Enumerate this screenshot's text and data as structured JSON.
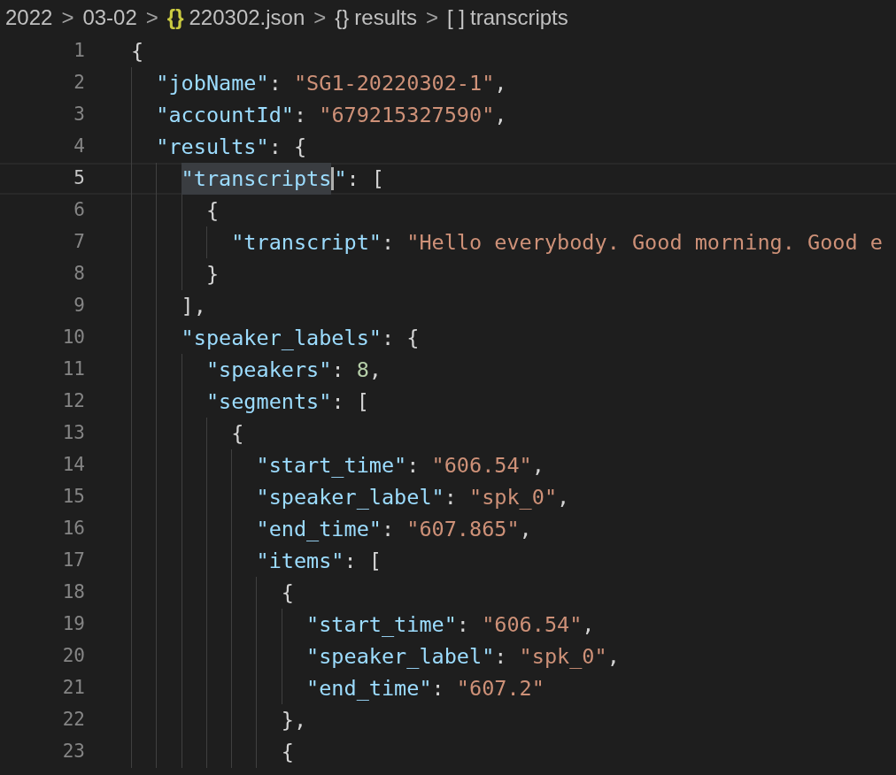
{
  "breadcrumb": [
    {
      "kind": "folder",
      "label": "2022"
    },
    {
      "kind": "folder",
      "label": "03-02"
    },
    {
      "kind": "file",
      "icon": "{}",
      "label": "220302.json"
    },
    {
      "kind": "object",
      "icon": "{}",
      "label": "results"
    },
    {
      "kind": "array",
      "icon": "[ ]",
      "label": "transcripts"
    }
  ],
  "separator": ">",
  "lines": [
    {
      "number": "1",
      "current": false,
      "tokens": [
        {
          "kind": "punct",
          "text": "{"
        }
      ]
    },
    {
      "number": "2",
      "current": false,
      "tokens": [
        {
          "kind": "key",
          "text": "  \"jobName\""
        },
        {
          "kind": "punct",
          "text": ": "
        },
        {
          "kind": "string",
          "text": "\"SG1-20220302-1\""
        },
        {
          "kind": "punct",
          "text": ","
        }
      ]
    },
    {
      "number": "3",
      "current": false,
      "tokens": [
        {
          "kind": "key",
          "text": "  \"accountId\""
        },
        {
          "kind": "punct",
          "text": ": "
        },
        {
          "kind": "string",
          "text": "\"679215327590\""
        },
        {
          "kind": "punct",
          "text": ","
        }
      ]
    },
    {
      "number": "4",
      "current": false,
      "tokens": [
        {
          "kind": "key",
          "text": "  \"results\""
        },
        {
          "kind": "punct",
          "text": ": {"
        }
      ]
    },
    {
      "number": "5",
      "current": true,
      "tokens": [
        {
          "kind": "key",
          "text": "    \"transcripts",
          "selected": true
        },
        {
          "kind": "cursor"
        },
        {
          "kind": "key",
          "text": "\""
        },
        {
          "kind": "punct",
          "text": ": ["
        }
      ]
    },
    {
      "number": "6",
      "current": false,
      "tokens": [
        {
          "kind": "punct",
          "text": "      {"
        }
      ]
    },
    {
      "number": "7",
      "current": false,
      "tokens": [
        {
          "kind": "key",
          "text": "        \"transcript\""
        },
        {
          "kind": "punct",
          "text": ": "
        },
        {
          "kind": "string",
          "text": "\"Hello everybody. Good morning. Good e"
        }
      ]
    },
    {
      "number": "8",
      "current": false,
      "tokens": [
        {
          "kind": "punct",
          "text": "      }"
        }
      ]
    },
    {
      "number": "9",
      "current": false,
      "tokens": [
        {
          "kind": "punct",
          "text": "    ],"
        }
      ]
    },
    {
      "number": "10",
      "current": false,
      "tokens": [
        {
          "kind": "key",
          "text": "    \"speaker_labels\""
        },
        {
          "kind": "punct",
          "text": ": {"
        }
      ]
    },
    {
      "number": "11",
      "current": false,
      "tokens": [
        {
          "kind": "key",
          "text": "      \"speakers\""
        },
        {
          "kind": "punct",
          "text": ": "
        },
        {
          "kind": "number",
          "text": "8"
        },
        {
          "kind": "punct",
          "text": ","
        }
      ]
    },
    {
      "number": "12",
      "current": false,
      "tokens": [
        {
          "kind": "key",
          "text": "      \"segments\""
        },
        {
          "kind": "punct",
          "text": ": ["
        }
      ]
    },
    {
      "number": "13",
      "current": false,
      "tokens": [
        {
          "kind": "punct",
          "text": "        {"
        }
      ]
    },
    {
      "number": "14",
      "current": false,
      "tokens": [
        {
          "kind": "key",
          "text": "          \"start_time\""
        },
        {
          "kind": "punct",
          "text": ": "
        },
        {
          "kind": "string",
          "text": "\"606.54\""
        },
        {
          "kind": "punct",
          "text": ","
        }
      ]
    },
    {
      "number": "15",
      "current": false,
      "tokens": [
        {
          "kind": "key",
          "text": "          \"speaker_label\""
        },
        {
          "kind": "punct",
          "text": ": "
        },
        {
          "kind": "string",
          "text": "\"spk_0\""
        },
        {
          "kind": "punct",
          "text": ","
        }
      ]
    },
    {
      "number": "16",
      "current": false,
      "tokens": [
        {
          "kind": "key",
          "text": "          \"end_time\""
        },
        {
          "kind": "punct",
          "text": ": "
        },
        {
          "kind": "string",
          "text": "\"607.865\""
        },
        {
          "kind": "punct",
          "text": ","
        }
      ]
    },
    {
      "number": "17",
      "current": false,
      "tokens": [
        {
          "kind": "key",
          "text": "          \"items\""
        },
        {
          "kind": "punct",
          "text": ": ["
        }
      ]
    },
    {
      "number": "18",
      "current": false,
      "tokens": [
        {
          "kind": "punct",
          "text": "            {"
        }
      ]
    },
    {
      "number": "19",
      "current": false,
      "tokens": [
        {
          "kind": "key",
          "text": "              \"start_time\""
        },
        {
          "kind": "punct",
          "text": ": "
        },
        {
          "kind": "string",
          "text": "\"606.54\""
        },
        {
          "kind": "punct",
          "text": ","
        }
      ]
    },
    {
      "number": "20",
      "current": false,
      "tokens": [
        {
          "kind": "key",
          "text": "              \"speaker_label\""
        },
        {
          "kind": "punct",
          "text": ": "
        },
        {
          "kind": "string",
          "text": "\"spk_0\""
        },
        {
          "kind": "punct",
          "text": ","
        }
      ]
    },
    {
      "number": "21",
      "current": false,
      "tokens": [
        {
          "kind": "key",
          "text": "              \"end_time\""
        },
        {
          "kind": "punct",
          "text": ": "
        },
        {
          "kind": "string",
          "text": "\"607.2\""
        }
      ]
    },
    {
      "number": "22",
      "current": false,
      "tokens": [
        {
          "kind": "punct",
          "text": "            },"
        }
      ]
    },
    {
      "number": "23",
      "current": false,
      "tokens": [
        {
          "kind": "punct",
          "text": "            {"
        }
      ]
    }
  ]
}
